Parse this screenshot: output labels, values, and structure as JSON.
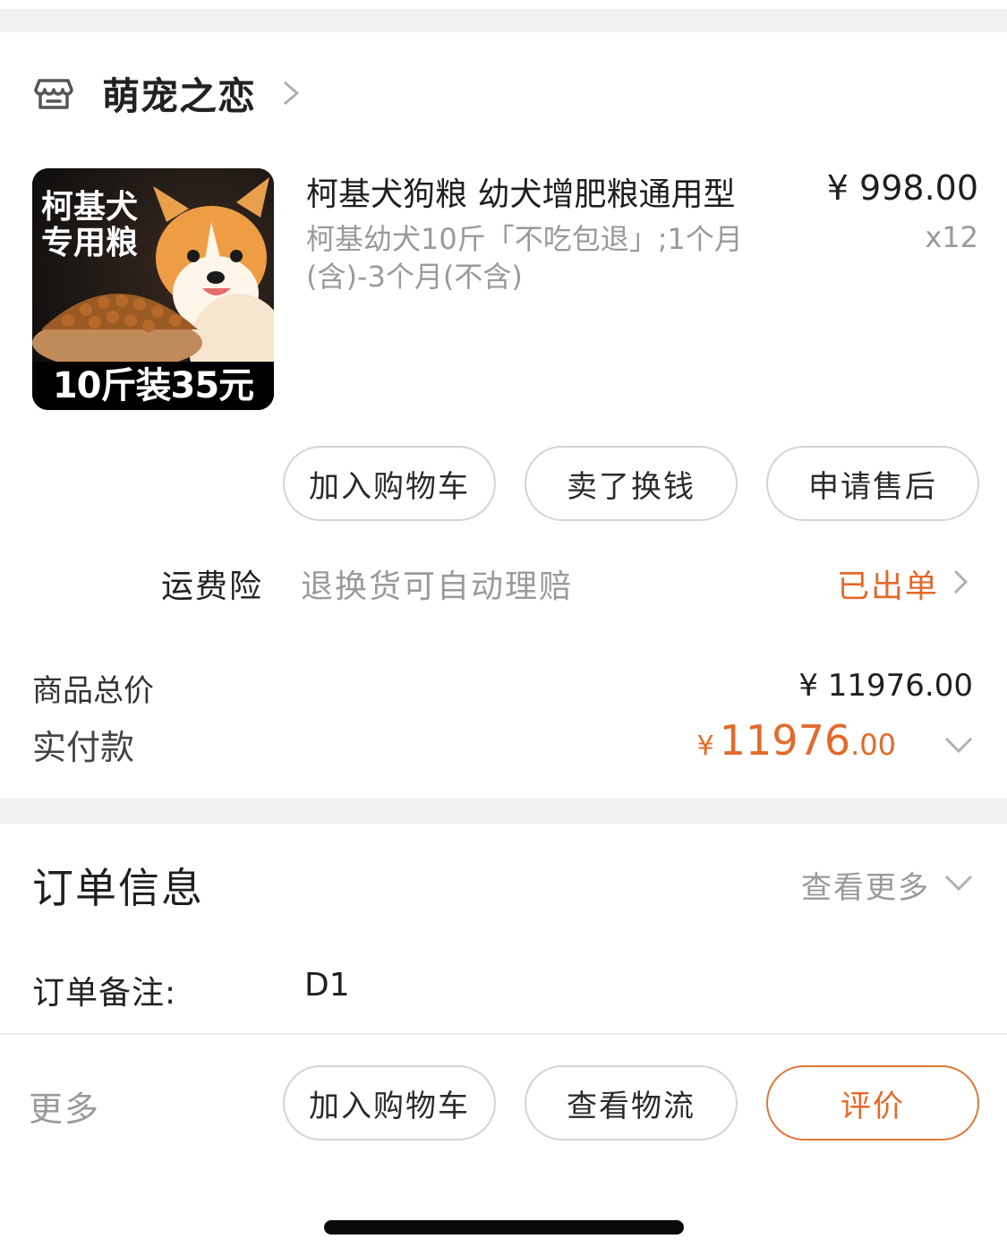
{
  "shop": {
    "name": "萌宠之恋",
    "icon": "store-icon"
  },
  "product": {
    "image_text_top": "柯基犬\n专用粮",
    "image_text_bottom": "10斤装35元",
    "title": "柯基犬狗粮 幼犬增肥粮通用型",
    "spec": "柯基幼犬10斤「不吃包退」;1个月(含)-3个月(不含)",
    "price": "¥ 998.00",
    "quantity": "x12"
  },
  "item_actions": [
    "加入购物车",
    "卖了换钱",
    "申请售后"
  ],
  "insurance": {
    "label": "运费险",
    "desc": "退换货可自动理赔",
    "status": "已出单"
  },
  "totals": {
    "goods_label": "商品总价",
    "goods_value": "¥ 11976.00",
    "paid_label": "实付款",
    "paid_yen": "¥",
    "paid_int": "11976",
    "paid_dec": ".00"
  },
  "order_info": {
    "title": "订单信息",
    "view_more": "查看更多",
    "note_label": "订单备注:",
    "note_value": "D1"
  },
  "footer": {
    "more": "更多",
    "actions": [
      "加入购物车",
      "查看物流",
      "评价"
    ]
  },
  "colors": {
    "accent": "#e4692a",
    "muted": "#9a9a9a",
    "separator": "#f1f1f1"
  }
}
